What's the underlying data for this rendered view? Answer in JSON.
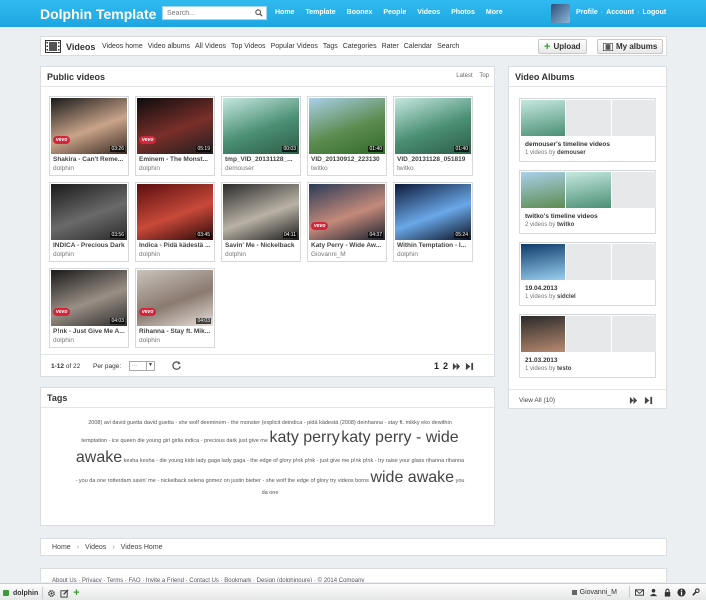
{
  "site": {
    "logo": "Dolphin Template"
  },
  "search": {
    "placeholder": "Search..."
  },
  "topnav": [
    "Home",
    "Template",
    "Boonex",
    "People",
    "Videos",
    "Photos",
    "More"
  ],
  "userlinks": {
    "profile": "Profile",
    "account": "Account",
    "logout": "Logout",
    "sep": "·"
  },
  "submenu": {
    "title": "Videos",
    "links": [
      "Videos home",
      "Video albums",
      "All Videos",
      "Top Videos",
      "Popular Videos",
      "Tags",
      "Categories",
      "Rater",
      "Calendar",
      "Search"
    ],
    "upload_label": "Upload",
    "myalbums_label": "My albums"
  },
  "public_videos": {
    "title": "Public videos",
    "tabs": [
      "Latest",
      "Top"
    ],
    "vevo_label": "vevo",
    "videos": [
      {
        "title": "Shakira - Can't Reme...",
        "author": "dolphin",
        "duration": "03:26",
        "vevo": true,
        "thumb": [
          "#1b1b1b",
          "#c9a48a",
          "#3a2a22"
        ]
      },
      {
        "title": "Eminem - The Monst...",
        "author": "dolphin",
        "duration": "05:19",
        "vevo": true,
        "thumb": [
          "#0d0d0d",
          "#7a2f2a",
          "#1e1e1e"
        ]
      },
      {
        "title": "tmp_VID_20131128_...",
        "author": "demouser",
        "duration": "00:03",
        "vevo": false,
        "thumb": [
          "#c6e8e0",
          "#4a8f74",
          "#2d5c46"
        ]
      },
      {
        "title": "VID_20130912_223130",
        "author": "twitko",
        "duration": "01:40",
        "vevo": false,
        "thumb": [
          "#a9d0e8",
          "#5d8c50",
          "#2f6a2a"
        ]
      },
      {
        "title": "VID_20131128_051819",
        "author": "twitko",
        "duration": "01:40",
        "vevo": false,
        "thumb": [
          "#c6e8e0",
          "#4a8f74",
          "#2d5c46"
        ]
      },
      {
        "title": "INDICA - Precious Dark",
        "author": "dolphin",
        "duration": "03:56",
        "vevo": false,
        "thumb": [
          "#1a1a1a",
          "#6a6a6a",
          "#2a2a2a"
        ]
      },
      {
        "title": "Indica - Pidä kädestä ...",
        "author": "dolphin",
        "duration": "03:45",
        "vevo": false,
        "thumb": [
          "#5a0e0e",
          "#c84a3a",
          "#2b0808"
        ]
      },
      {
        "title": "Savin' Me - Nickelback",
        "author": "dolphin",
        "duration": "04:11",
        "vevo": false,
        "thumb": [
          "#2a2a2a",
          "#b9b2a6",
          "#1c1c1c"
        ]
      },
      {
        "title": "Katy Perry - Wide Aw...",
        "author": "Giovanni_M",
        "duration": "04:37",
        "vevo": true,
        "thumb": [
          "#2a3a55",
          "#c48a7a",
          "#1a2230"
        ]
      },
      {
        "title": "Within Temptation - I...",
        "author": "dolphin",
        "duration": "05:24",
        "vevo": false,
        "thumb": [
          "#0d1a3a",
          "#6aa8e8",
          "#0a1020"
        ]
      },
      {
        "title": "P!nk - Just Give Me A...",
        "author": "dolphin",
        "duration": "04:03",
        "vevo": true,
        "thumb": [
          "#1a1a1a",
          "#9a8f85",
          "#2e2e2e"
        ]
      },
      {
        "title": "Rihanna - Stay ft. Mik...",
        "author": "dolphin",
        "duration": "04:03",
        "vevo": true,
        "thumb": [
          "#c9c3bc",
          "#8a7a70",
          "#e6e0da"
        ]
      }
    ],
    "pager": {
      "count_range": "1-12",
      "count_of": " of 22",
      "per_page_label": "Per page:",
      "per_page_value": "...",
      "pages": [
        "1",
        "2"
      ]
    }
  },
  "video_albums": {
    "title": "Video Albums",
    "albums": [
      {
        "title": "demouser's timeline videos",
        "count": "1 videos by",
        "owner": "demouser",
        "thumbs": [
          [
            "#c6e8e0",
            "#4a8f74"
          ],
          null,
          null
        ]
      },
      {
        "title": "twitko's timeline videos",
        "count": "2 videos by",
        "owner": "twitko",
        "thumbs": [
          [
            "#a9d0e8",
            "#5d8c50"
          ],
          [
            "#c6e8e0",
            "#4a8f74"
          ],
          null
        ]
      },
      {
        "title": "19.04.2013",
        "count": "1 videos by",
        "owner": "sidclel",
        "thumbs": [
          [
            "#0d3a6a",
            "#9ad0f0"
          ],
          null,
          null
        ]
      },
      {
        "title": "21.03.2013",
        "count": "1 videos by",
        "owner": "testo",
        "thumbs": [
          [
            "#2a2a2a",
            "#b98a70"
          ],
          null,
          null
        ]
      }
    ],
    "view_all": "View All (10)"
  },
  "tags": {
    "title": "Tags",
    "lines": [
      [
        [
          "2008)",
          0
        ],
        [
          "avi",
          0
        ],
        [
          "david guetta",
          0
        ],
        [
          "david guetta - she wolf",
          0
        ],
        [
          "deeminem - the monster (explicit",
          0
        ],
        [
          "deindica - pidä kädestä (2008)",
          0
        ],
        [
          "deinhanna - stay ft. mikky eko",
          0
        ],
        [
          "dewithin",
          0
        ]
      ],
      [
        [
          "temptation - ice queen",
          0
        ],
        [
          "die young",
          0
        ],
        [
          "girl",
          0
        ],
        [
          "girlia",
          0
        ],
        [
          "indica - precious dark",
          0
        ],
        [
          "just give me",
          0
        ],
        [
          "katy perry",
          1
        ],
        [
          "katy perry - wide",
          1
        ]
      ],
      [
        [
          "awake",
          1
        ],
        [
          "kesha",
          0
        ],
        [
          "kesha - die young",
          0
        ],
        [
          "kids",
          0
        ],
        [
          "lady gaga",
          0
        ],
        [
          "lady gaga - the edge of glory",
          0
        ],
        [
          "p!nk",
          0
        ],
        [
          "p!nk - just give me",
          0
        ],
        [
          "p!nk",
          0
        ],
        [
          "p!nk - try",
          0
        ],
        [
          "raise your glass",
          0
        ],
        [
          "rihanna",
          0
        ],
        [
          "rihanna",
          0
        ]
      ],
      [
        [
          "- you da one",
          0
        ],
        [
          "rotterdam",
          0
        ],
        [
          "savin' me - nickelback",
          0
        ],
        [
          "selena gomez on justin bieber - she wolf",
          0
        ],
        [
          "the edge of glory",
          0
        ],
        [
          "try",
          0
        ],
        [
          "videos borns",
          0
        ],
        [
          "wide awake",
          1
        ],
        [
          "you",
          0
        ]
      ],
      [
        [
          "da one",
          0
        ]
      ]
    ]
  },
  "breadcrumb": [
    "Home",
    "Videos",
    "Videos Home"
  ],
  "breadcrumb_sep": "›",
  "footer": {
    "links": "About Us · Privacy · Terms · FAQ · Invite a Friend · Contact Us · Bookmark · Design (dolphinpure) · © 2014 Company"
  },
  "bottombar": {
    "site": "dolphin",
    "user": "Giovanni_M"
  },
  "colors": {
    "topbar": "#1ea6e0",
    "accent_green": "#3a9b36",
    "vevo": "#d4263a"
  }
}
